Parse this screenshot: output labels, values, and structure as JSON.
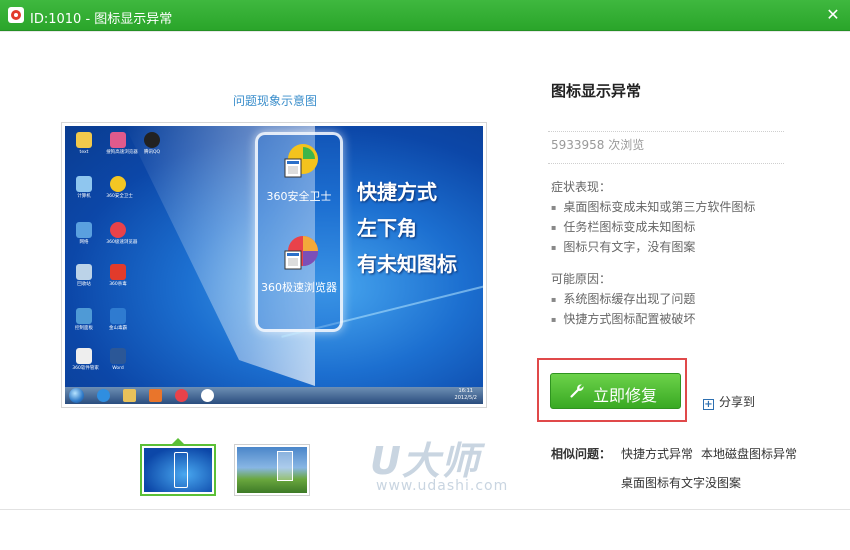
{
  "window": {
    "title": "ID:1010 - 图标显示异常",
    "close_glyph": "✕"
  },
  "preview": {
    "caption": "问题现象示意图",
    "highlight_labels": [
      "360安全卫士",
      "360极速浏览器"
    ],
    "overlay_lines": [
      "快捷方式",
      "左下角",
      "有未知图标"
    ],
    "desktop_icons": [
      "text",
      "搜狗高速浏览器",
      "腾讯QQ",
      "计算机",
      "360安全卫士",
      "网络",
      "360极速浏览器",
      "回收站",
      "360杀毒",
      "控制面板",
      "金山毒霸",
      "360软件管家",
      "Word"
    ],
    "clock": [
      "16:11",
      "2012/5/2"
    ],
    "active_thumb": 0
  },
  "watermark": {
    "logo": "U大师",
    "url": "www.udashi.com"
  },
  "detail": {
    "title": "图标显示异常",
    "views": "5933958 次浏览",
    "symptoms_label": "症状表现：",
    "symptoms": [
      "桌面图标变成未知或第三方软件图标",
      "任务栏图标变成未知图标",
      "图标只有文字，没有图案"
    ],
    "causes_label": "可能原因：",
    "causes": [
      "系统图标缓存出现了问题",
      "快捷方式图标配置被破坏"
    ],
    "fix_label": "立即修复",
    "share_label": "分享到",
    "share_glyph": "+",
    "related_label": "相似问题：",
    "related": [
      "快捷方式异常",
      "本地磁盘图标异常",
      "桌面图标有文字没图案"
    ]
  },
  "colors": {
    "titlebar": "#2aa52a",
    "fix_button": "#39a923",
    "highlight_border": "#e0494a",
    "caption": "#3a8ecb"
  }
}
